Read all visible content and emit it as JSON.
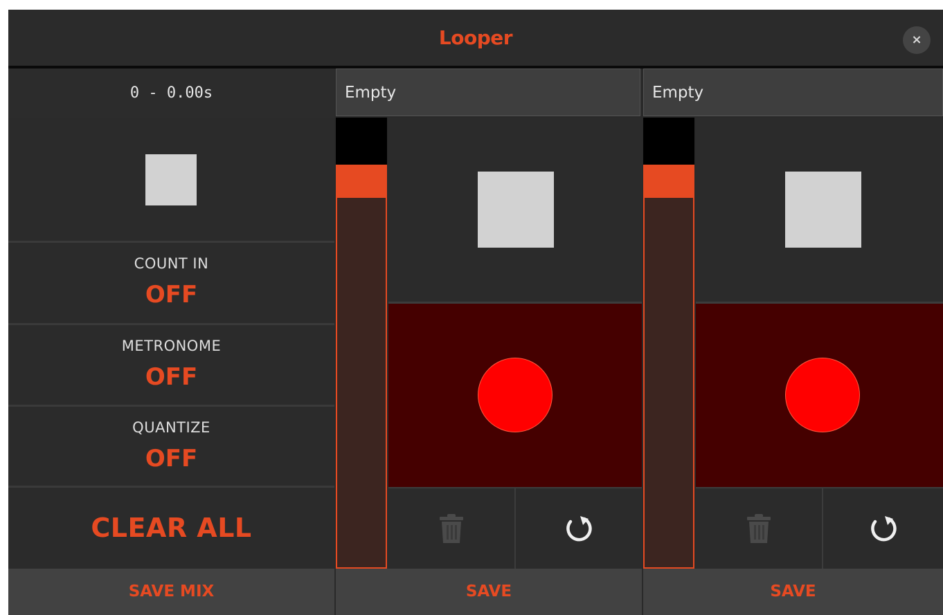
{
  "window": {
    "title": "Looper",
    "close_label": "×"
  },
  "transport": {
    "time": "0 - 0.00s"
  },
  "settings": [
    {
      "label": "COUNT IN",
      "value": "OFF"
    },
    {
      "label": "METRONOME",
      "value": "OFF"
    },
    {
      "label": "QUANTIZE",
      "value": "OFF"
    }
  ],
  "clear_all_label": "CLEAR ALL",
  "save_mix_label": "SAVE MIX",
  "tracks": [
    {
      "name": "Empty",
      "save_label": "SAVE",
      "volume": 0.9
    },
    {
      "name": "Empty",
      "save_label": "SAVE",
      "volume": 0.9
    }
  ],
  "colors": {
    "accent": "#e64a22",
    "record": "#ff0000",
    "record_bg": "#450000",
    "panel": "#2b2b2b"
  },
  "icons": {
    "close": "close-icon",
    "stop": "stop-icon",
    "record": "record-icon",
    "trash": "trash-icon",
    "undo": "undo-icon"
  }
}
